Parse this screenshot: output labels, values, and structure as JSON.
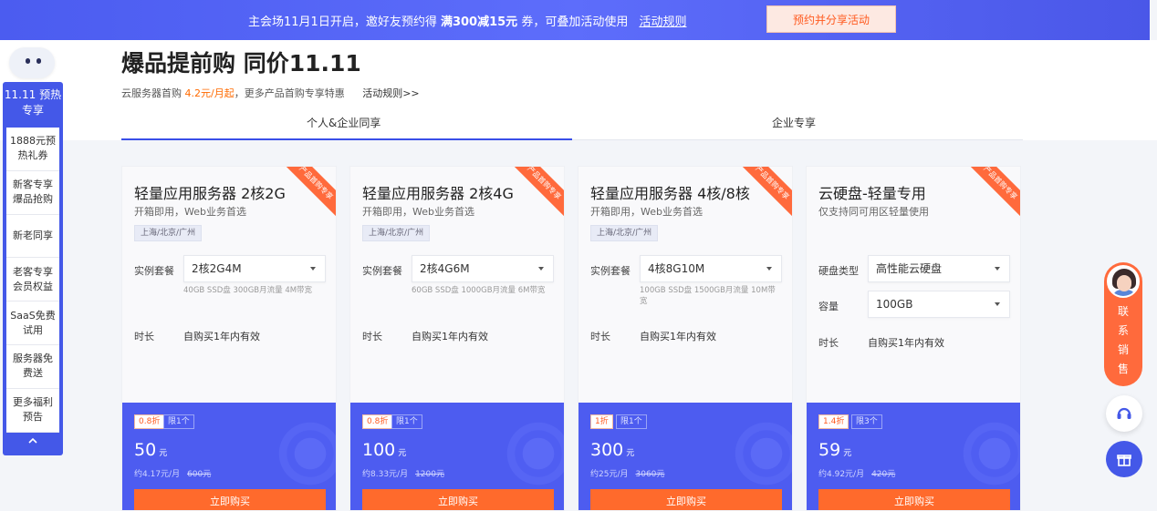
{
  "topbar": {
    "text_pre": "主会场11月1日开启，邀好友预约得 ",
    "text_bold": "满300减15元",
    "text_post": " 券，可叠加活动使用",
    "rules_link": "活动规则",
    "share_button": "预约并分享活动"
  },
  "header": {
    "title": "爆品提前购 同价11.11",
    "subtitle_pre": "云服务器首购 ",
    "subtitle_price": "4.2元/月起",
    "subtitle_post": "，更多产品首购专享特惠",
    "rules_link": "活动规则>>"
  },
  "tabs": [
    {
      "label": "个人&企业同享",
      "active": true
    },
    {
      "label": "企业专享",
      "active": false
    }
  ],
  "sidebar": {
    "header": "11.11 预热专享",
    "items": [
      {
        "label": "1888元预热礼券"
      },
      {
        "label": "新客专享爆品抢购"
      },
      {
        "label": "新老同享"
      },
      {
        "label": "老客专享会员权益"
      },
      {
        "label": "SaaS免费试用"
      },
      {
        "label": "服务器免费送"
      },
      {
        "label": "更多福利预告"
      }
    ],
    "up_icon": "^"
  },
  "cards": [
    {
      "title": "轻量应用服务器 2核2G",
      "desc": "开箱即用，Web业务首选",
      "region": "上海/北京/广州",
      "ribbon": "产品首购专享",
      "field1_label": "实例套餐",
      "field1_value": "2核2G4M",
      "spec": "40GB SSD盘 300GB月流量 4M带宽",
      "duration_label": "时长",
      "duration_value": "自购买1年内有效",
      "discount": "0.8折",
      "limit": "限1个",
      "price": "50",
      "price_unit": "元",
      "monthly": "约4.17元/月",
      "original": "600元",
      "buy": "立即购买"
    },
    {
      "title": "轻量应用服务器 2核4G",
      "desc": "开箱即用，Web业务首选",
      "region": "上海/北京/广州",
      "ribbon": "产品首购专享",
      "field1_label": "实例套餐",
      "field1_value": "2核4G6M",
      "spec": "60GB SSD盘 1000GB月流量 6M带宽",
      "duration_label": "时长",
      "duration_value": "自购买1年内有效",
      "discount": "0.8折",
      "limit": "限1个",
      "price": "100",
      "price_unit": "元",
      "monthly": "约8.33元/月",
      "original": "1200元",
      "buy": "立即购买"
    },
    {
      "title": "轻量应用服务器 4核/8核",
      "desc": "开箱即用，Web业务首选",
      "region": "上海/北京/广州",
      "ribbon": "产品首购专享",
      "field1_label": "实例套餐",
      "field1_value": "4核8G10M",
      "spec": "100GB SSD盘 1500GB月流量 10M带宽",
      "duration_label": "时长",
      "duration_value": "自购买1年内有效",
      "discount": "1折",
      "limit": "限1个",
      "price": "300",
      "price_unit": "元",
      "monthly": "约25元/月",
      "original": "3060元",
      "buy": "立即购买"
    },
    {
      "title": "云硬盘-轻量专用",
      "desc": "仅支持同可用区轻量使用",
      "ribbon": "产品首购专享",
      "field1_label": "硬盘类型",
      "field1_value": "高性能云硬盘",
      "field2_label": "容量",
      "field2_value": "100GB",
      "duration_label": "时长",
      "duration_value": "自购买1年内有效",
      "discount": "1.4折",
      "limit": "限3个",
      "price": "59",
      "price_unit": "元",
      "monthly": "约4.92元/月",
      "original": "420元",
      "buy": "立即购买"
    }
  ],
  "floaters": {
    "contact": "联系销售"
  },
  "colors": {
    "brand": "#4458e8",
    "accent": "#ff6a2c"
  }
}
